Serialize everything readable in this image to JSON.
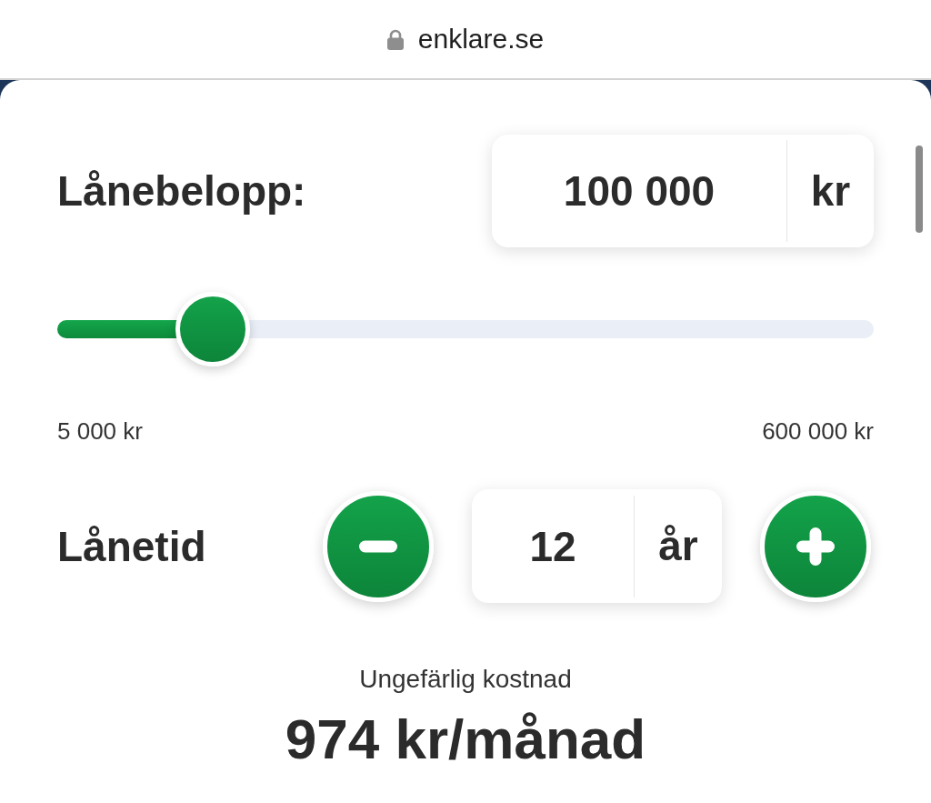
{
  "browser": {
    "url": "enklare.se"
  },
  "loan_amount": {
    "label": "Lånebelopp:",
    "value": "100 000",
    "unit": "kr"
  },
  "slider": {
    "level": 0.19,
    "min_label": "5 000 kr",
    "max_label": "600 000 kr"
  },
  "loan_term": {
    "label": "Lånetid",
    "value": "12",
    "unit": "år"
  },
  "result": {
    "caption": "Ungefärlig kostnad",
    "value": "974 kr/månad"
  }
}
